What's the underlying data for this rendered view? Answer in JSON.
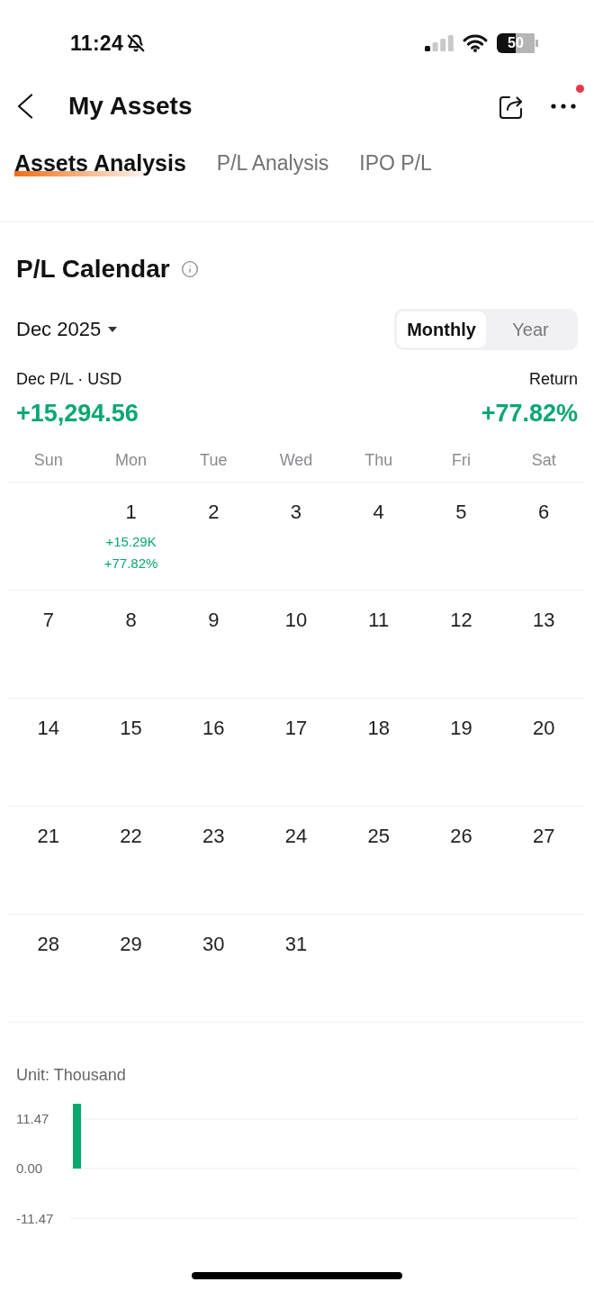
{
  "status_bar": {
    "time": "11:24",
    "battery": "50"
  },
  "header": {
    "title": "My Assets",
    "notification_dot": true
  },
  "tabs": [
    {
      "label": "Assets Analysis",
      "selected": true
    },
    {
      "label": "P/L Analysis",
      "selected": false
    },
    {
      "label": "IPO P/L",
      "selected": false
    }
  ],
  "pl_calendar": {
    "title": "P/L Calendar",
    "month": "Dec 2025",
    "periods": [
      {
        "label": "Monthly",
        "selected": true
      },
      {
        "label": "Year",
        "selected": false
      }
    ],
    "summary": {
      "pl_label": "Dec P/L · USD",
      "pl_value": "+15,294.56",
      "return_label": "Return",
      "return_value": "+77.82%"
    },
    "weekdays": [
      "Sun",
      "Mon",
      "Tue",
      "Wed",
      "Thu",
      "Fri",
      "Sat"
    ],
    "weeks": [
      {
        "mon": {
          "day": "1",
          "pl": "+15.29K",
          "return": "+77.82%"
        },
        "tue": {
          "day": "2"
        },
        "wed": {
          "day": "3"
        },
        "thu": {
          "day": "4"
        },
        "fri": {
          "day": "5"
        },
        "sat": {
          "day": "6"
        }
      },
      {
        "sun": {
          "day": "7"
        },
        "mon": {
          "day": "8"
        },
        "tue": {
          "day": "9"
        },
        "wed": {
          "day": "10"
        },
        "thu": {
          "day": "11"
        },
        "fri": {
          "day": "12"
        },
        "sat": {
          "day": "13"
        }
      },
      {
        "sun": {
          "day": "14"
        },
        "mon": {
          "day": "15"
        },
        "tue": {
          "day": "16"
        },
        "wed": {
          "day": "17"
        },
        "thu": {
          "day": "18"
        },
        "fri": {
          "day": "19"
        },
        "sat": {
          "day": "20"
        }
      },
      {
        "sun": {
          "day": "21"
        },
        "mon": {
          "day": "22"
        },
        "tue": {
          "day": "23"
        },
        "wed": {
          "day": "24"
        },
        "thu": {
          "day": "25"
        },
        "fri": {
          "day": "26"
        },
        "sat": {
          "day": "27"
        }
      },
      {
        "sun": {
          "day": "28"
        },
        "mon": {
          "day": "29"
        },
        "tue": {
          "day": "30"
        },
        "wed": {
          "day": "31"
        }
      }
    ]
  },
  "pl_chart": {
    "unit": "Unit: Thousand",
    "chart_data": {
      "type": "bar",
      "values": [
        15,
        null,
        null,
        null,
        null,
        null,
        null,
        null,
        null,
        null,
        null,
        null,
        null,
        null,
        null,
        null,
        null,
        null,
        null,
        null,
        null,
        null,
        null,
        null,
        null,
        null,
        null,
        null,
        null,
        null,
        null
      ],
      "ylim": [
        -11.47,
        15
      ],
      "yticks": [
        {
          "value": 11.47,
          "label": "11.47"
        },
        {
          "value": 0,
          "label": "0.00"
        },
        {
          "value": -11.47,
          "label": "-11.47"
        }
      ],
      "grid": true
    }
  }
}
